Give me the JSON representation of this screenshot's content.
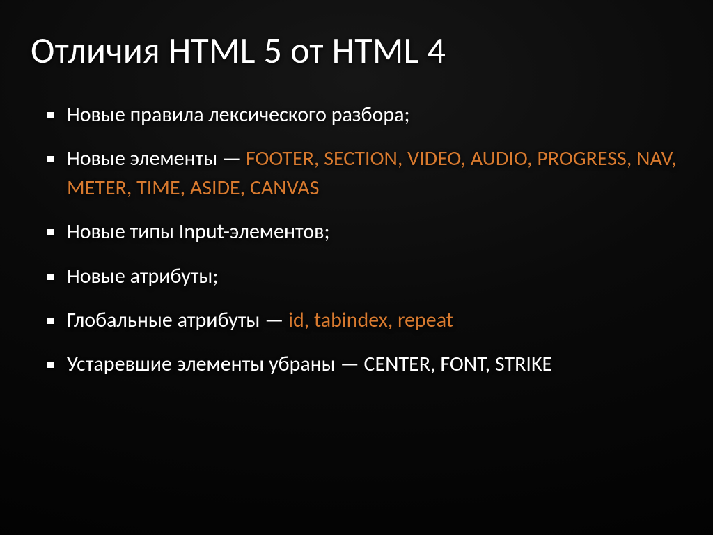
{
  "title": "Отличия HTML 5 от HTML 4",
  "bullets": {
    "b0": {
      "text": "Новые правила лексического разбора;"
    },
    "b1": {
      "prefix": "Новые элементы — ",
      "accent": "Footer, Section, Video, Audio, Progress, Nav, Meter, Time, Aside, Canvas"
    },
    "b2": {
      "text": "Новые типы Input-элементов;"
    },
    "b3": {
      "text": "Новые атрибуты;"
    },
    "b4": {
      "prefix": "Глобальные атрибуты — ",
      "accent": "id, tabindex, repeat"
    },
    "b5": {
      "prefix": "Устаревшие элементы убраны — ",
      "tail": "Center, Font, Strike"
    }
  },
  "colors": {
    "accent": "#d87a2f",
    "text": "#ffffff",
    "background": "#000000"
  }
}
